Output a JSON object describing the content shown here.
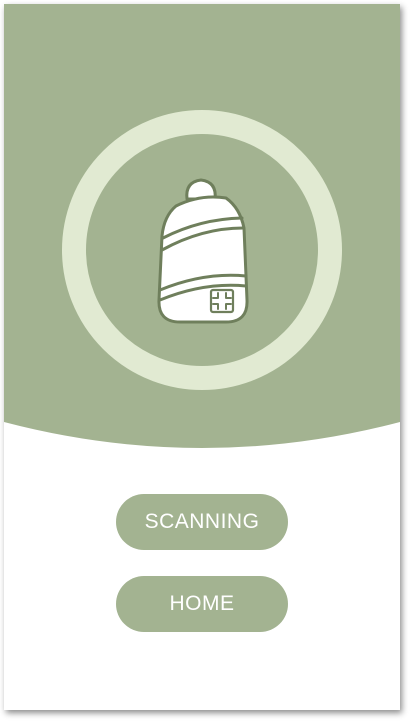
{
  "colors": {
    "header_green": "#a3b391",
    "ring_light": "#e1ead2",
    "icon_outline": "#6f7f5c",
    "button_text": "#ffffff",
    "background": "#ffffff"
  },
  "scan_status": {
    "icon": "scanning-bottle-icon"
  },
  "actions": {
    "scanning_label": "SCANNING",
    "home_label": "HOME"
  }
}
